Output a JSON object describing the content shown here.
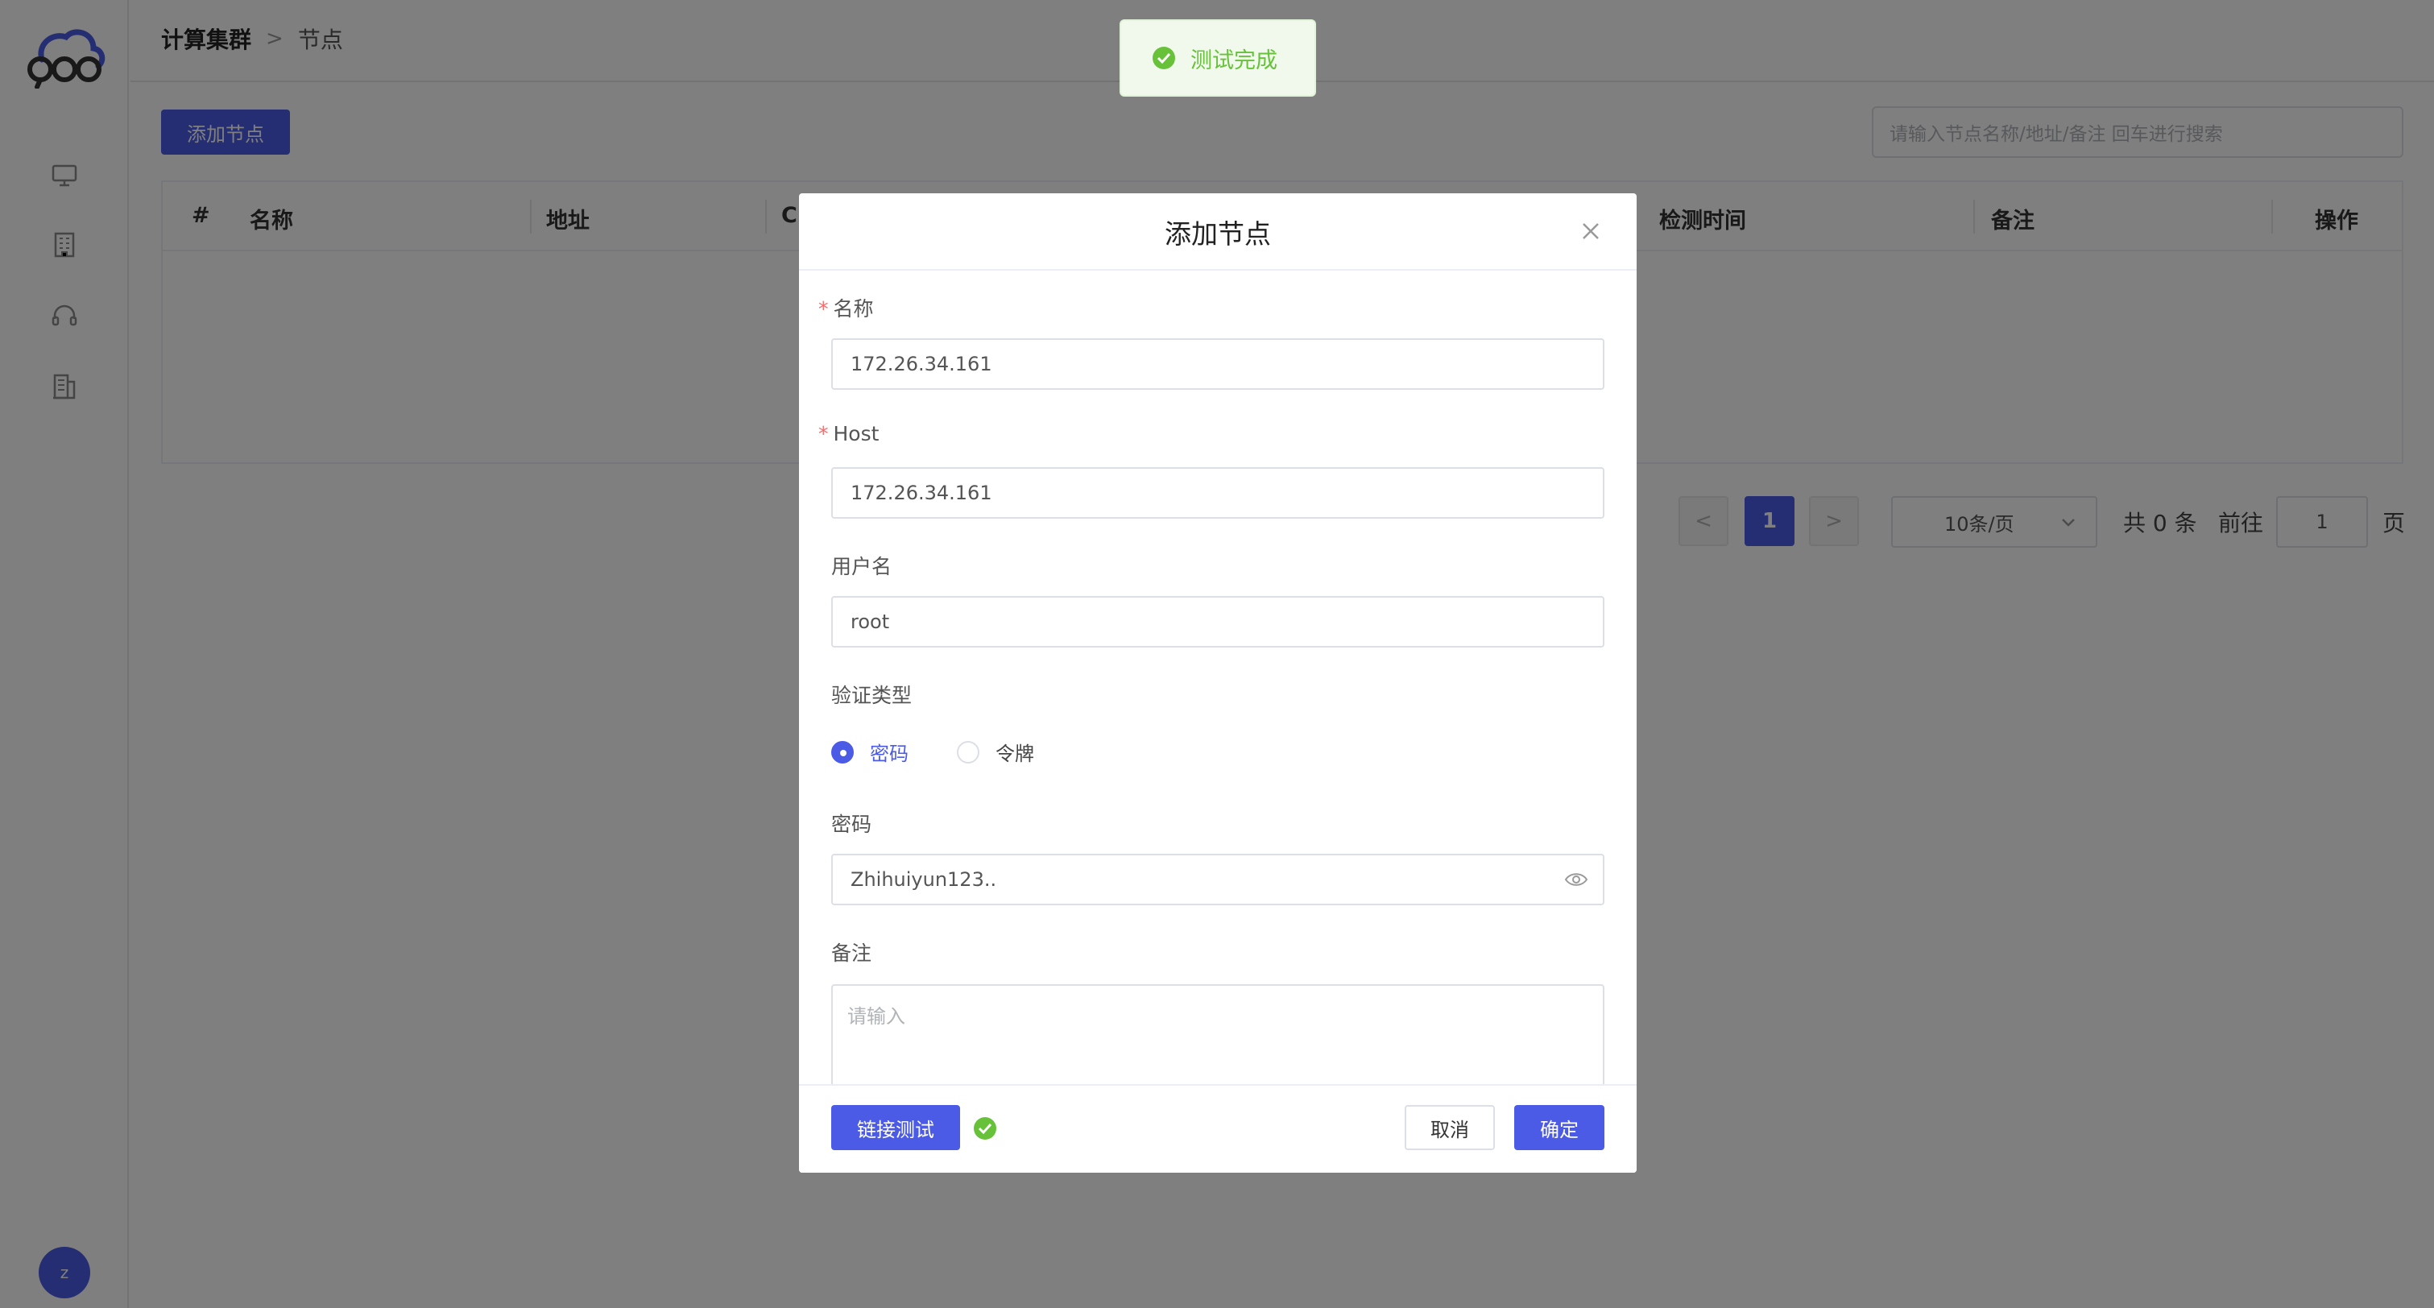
{
  "sidebar": {
    "icons": [
      "monitor-icon",
      "building-icon",
      "headset-icon",
      "office-icon"
    ],
    "avatar_letter": "z"
  },
  "breadcrumb": {
    "parent": "计算集群",
    "separator": ">",
    "current": "节点"
  },
  "toolbar": {
    "add_label": "添加节点",
    "search_placeholder": "请输入节点名称/地址/备注 回车进行搜索"
  },
  "table": {
    "columns": [
      "#",
      "名称",
      "地址",
      "C",
      "检测时间",
      "备注",
      "操作"
    ]
  },
  "pagination": {
    "prev": "<",
    "current_page": "1",
    "next": ">",
    "page_size": "10条/页",
    "total": "共 0 条",
    "goto_label": "前往",
    "goto_value": "1",
    "page_suffix": "页"
  },
  "toast": {
    "text": "测试完成",
    "color": "#67c23a"
  },
  "dialog": {
    "title": "添加节点",
    "fields": {
      "name": {
        "label": "名称",
        "required_mark": "*",
        "value": "172.26.34.161"
      },
      "host": {
        "label": "Host",
        "required_mark": "*",
        "value": "172.26.34.161"
      },
      "username": {
        "label": "用户名",
        "value": "root"
      },
      "auth_type": {
        "label": "验证类型",
        "options": [
          "密码",
          "令牌"
        ],
        "selected": "密码"
      },
      "password": {
        "label": "密码",
        "value": "Zhihuiyun123.."
      },
      "remark": {
        "label": "备注",
        "placeholder": "请输入"
      }
    },
    "footer": {
      "test_label": "链接测试",
      "cancel_label": "取消",
      "confirm_label": "确定"
    }
  },
  "colors": {
    "primary": "#4b5be6",
    "success": "#67c23a",
    "required": "#f56c6c"
  }
}
